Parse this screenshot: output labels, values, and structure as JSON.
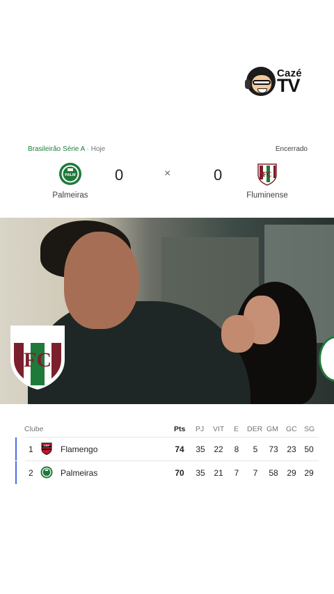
{
  "brand": {
    "line1": "Cazé",
    "line2": "TV"
  },
  "match": {
    "league": "Brasileirão Série A",
    "separator": "·",
    "day": "Hoje",
    "status": "Encerrado",
    "home": {
      "name": "Palmeiras",
      "score": "0"
    },
    "away": {
      "name": "Fluminense",
      "score": "0"
    },
    "vs": "×"
  },
  "video": {
    "overlay_left_badge": "fluminense-crest",
    "overlay_right_badge": "palmeiras-crest"
  },
  "standings": {
    "columns": [
      "Clube",
      "Pts",
      "PJ",
      "VIT",
      "E",
      "DER",
      "GM",
      "GC",
      "SG"
    ],
    "rows": [
      {
        "pos": "1",
        "club": "Flamengo",
        "pts": "74",
        "pj": "35",
        "vit": "22",
        "e": "8",
        "der": "5",
        "gm": "73",
        "gc": "23",
        "sg": "50"
      },
      {
        "pos": "2",
        "club": "Palmeiras",
        "pts": "70",
        "pj": "35",
        "vit": "21",
        "e": "7",
        "der": "7",
        "gm": "58",
        "gc": "29",
        "sg": "29"
      }
    ],
    "accent_color": "#4a6ee0"
  }
}
